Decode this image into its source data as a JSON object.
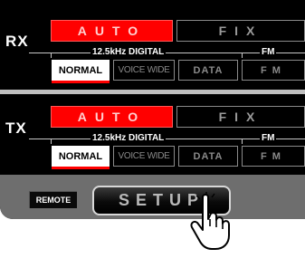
{
  "rx": {
    "label": "RX",
    "auto_label": "AUTO",
    "fix_label": "FIX",
    "digital_caption": "12.5kHz DIGITAL",
    "fm_caption": "FM",
    "options": [
      "NORMAL",
      "VOICE WIDE",
      "DATA",
      "FM"
    ],
    "selected": "NORMAL"
  },
  "tx": {
    "label": "TX",
    "auto_label": "AUTO",
    "fix_label": "FIX",
    "digital_caption": "12.5kHz DIGITAL",
    "fm_caption": "FM",
    "options": [
      "NORMAL",
      "VOICE WIDE",
      "DATA",
      "FM"
    ],
    "selected": "NORMAL"
  },
  "bottom": {
    "remote_label": "REMOTE",
    "setup_label": "SETUP"
  },
  "colors": {
    "active_red": "#ff0000",
    "panel_bg": "#000000",
    "bottom_bar": "#6e6e6e"
  },
  "icons": {
    "pointer": "hand-pointer-icon"
  }
}
